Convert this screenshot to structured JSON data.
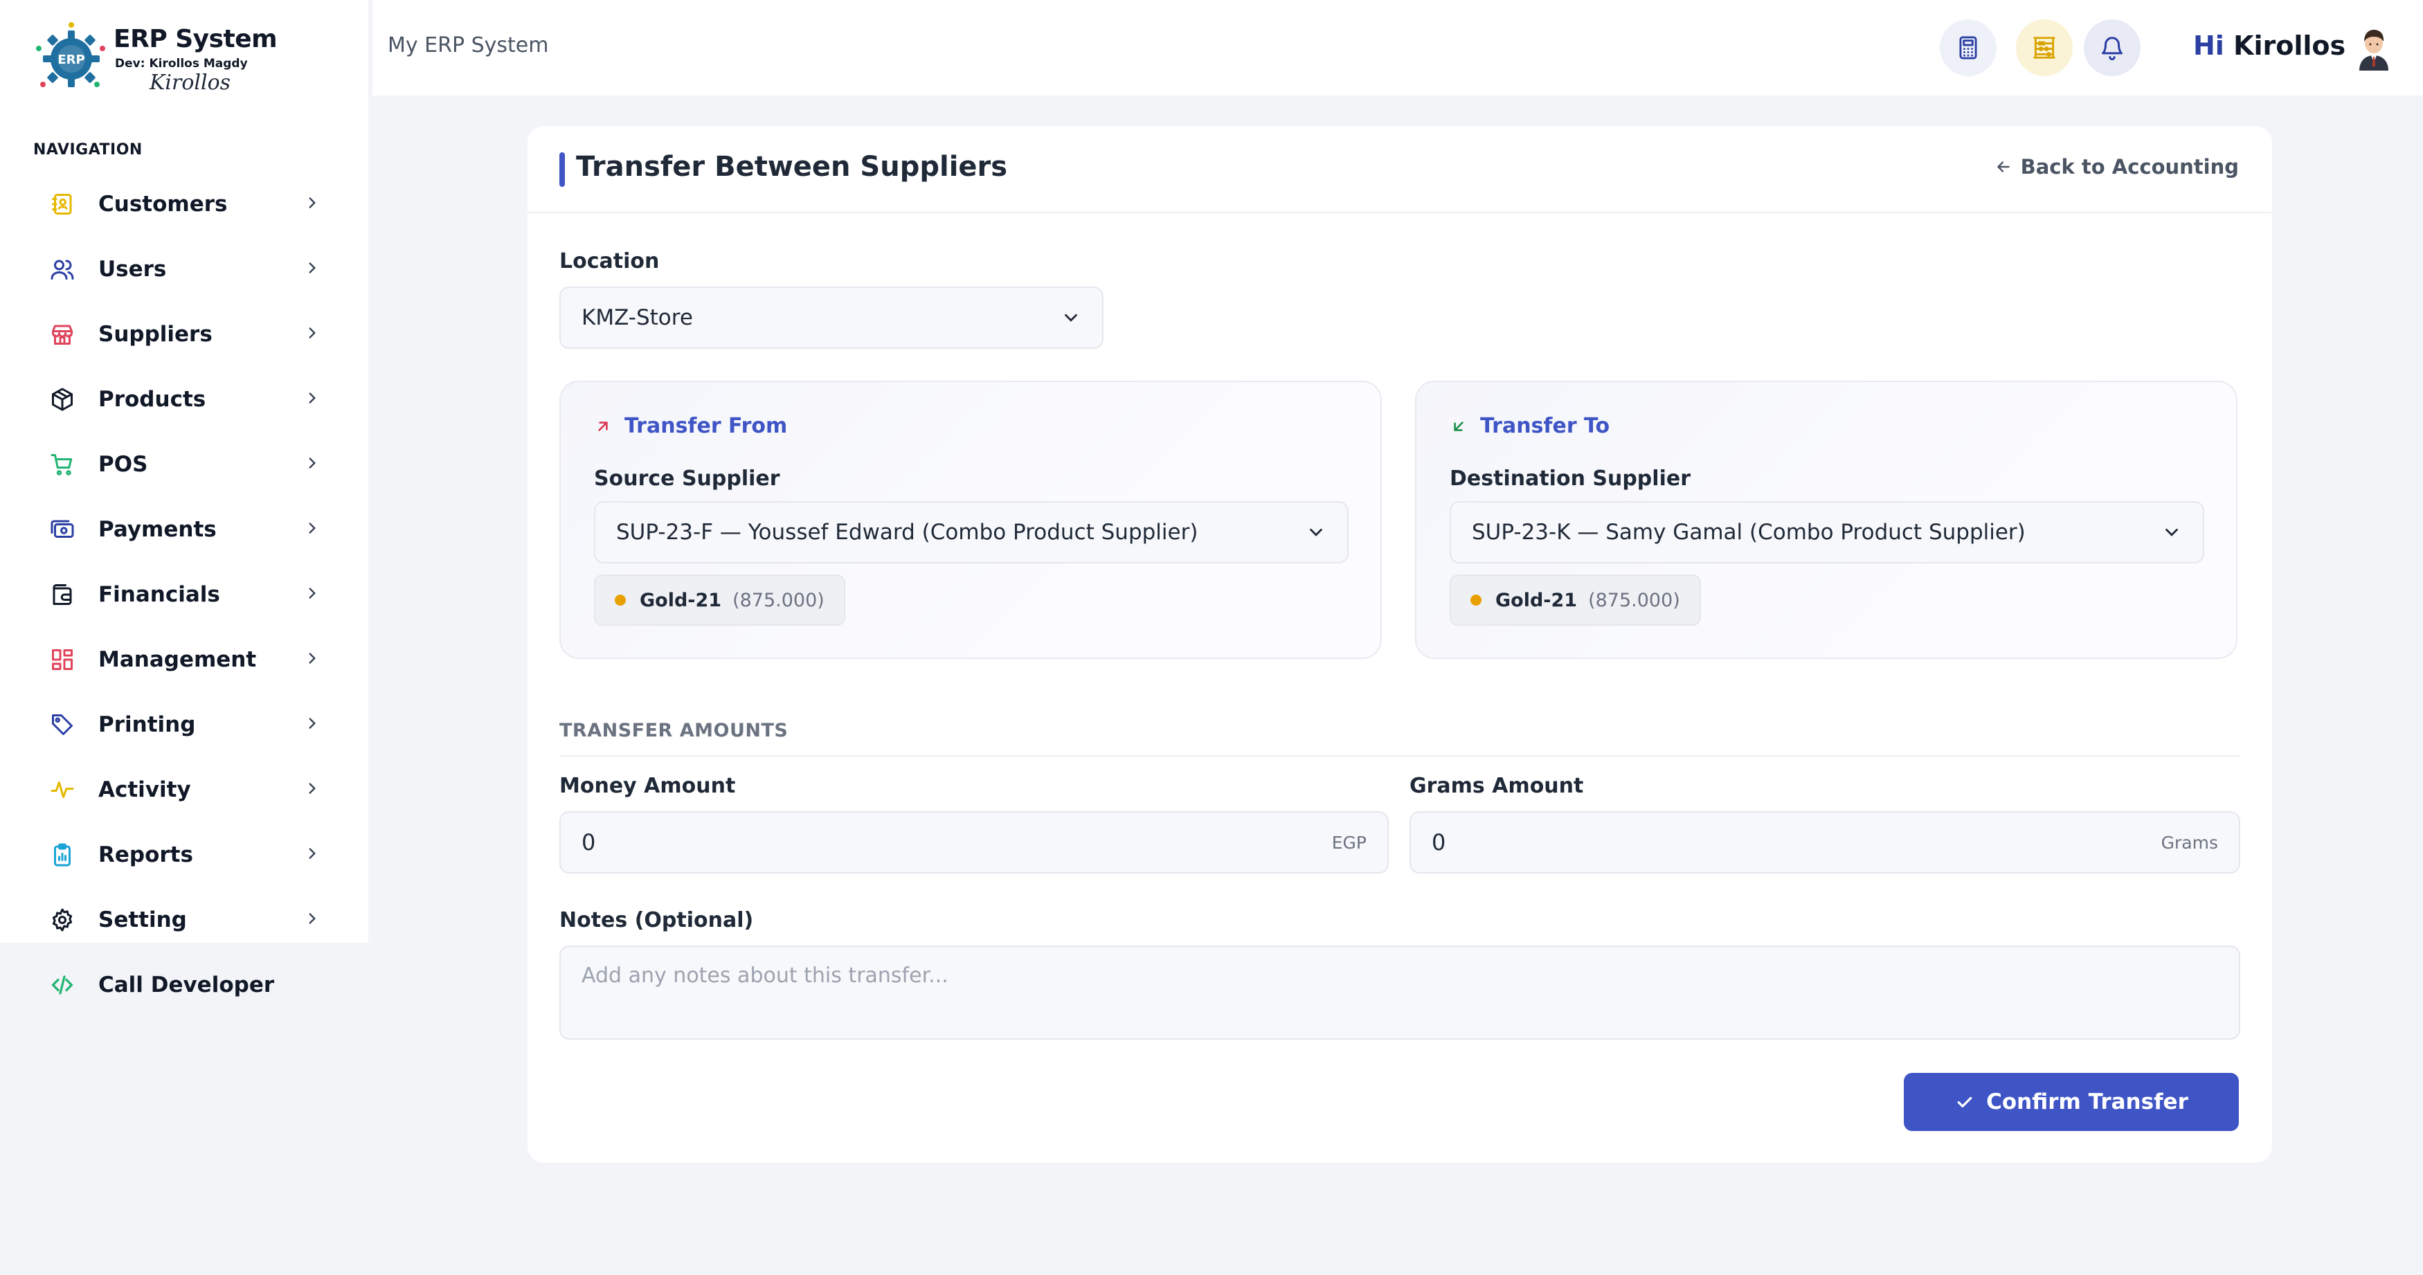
{
  "brand": {
    "logo_text": "ERP",
    "title": "ERP System",
    "dev": "Dev: Kirollos Magdy",
    "signature": "Kirollos"
  },
  "sidebar": {
    "heading": "NAVIGATION",
    "items": [
      {
        "label": "Customers",
        "icon": "contact-book-icon",
        "color": "#e5b800"
      },
      {
        "label": "Users",
        "icon": "users-icon",
        "color": "#2b3fa3"
      },
      {
        "label": "Suppliers",
        "icon": "store-icon",
        "color": "#e0445c"
      },
      {
        "label": "Products",
        "icon": "box-icon",
        "color": "#111827"
      },
      {
        "label": "POS",
        "icon": "cart-icon",
        "color": "#22b573"
      },
      {
        "label": "Payments",
        "icon": "money-icon",
        "color": "#2b3fa3"
      },
      {
        "label": "Financials",
        "icon": "wallet-icon",
        "color": "#111827"
      },
      {
        "label": "Management",
        "icon": "grid-icon",
        "color": "#e0445c"
      },
      {
        "label": "Printing",
        "icon": "tag-icon",
        "color": "#2b3fa3"
      },
      {
        "label": "Activity",
        "icon": "pulse-icon",
        "color": "#e5b800"
      },
      {
        "label": "Reports",
        "icon": "clipboard-icon",
        "color": "#1aa3d6"
      },
      {
        "label": "Setting",
        "icon": "gear-icon",
        "color": "#111827"
      }
    ],
    "call_developer": "Call Developer"
  },
  "topbar": {
    "app_name": "My ERP System",
    "greeting_hi": "Hi",
    "user_name": "Kirollos"
  },
  "page": {
    "title": "Transfer Between Suppliers",
    "back_label": "Back to Accounting",
    "location_label": "Location",
    "location_value": "KMZ-Store",
    "from": {
      "heading": "Transfer From",
      "label": "Source Supplier",
      "value": "SUP-23-F — Youssef Edward (Combo Product Supplier)",
      "tag_name": "Gold-21",
      "tag_qty": "(875.000)"
    },
    "to": {
      "heading": "Transfer To",
      "label": "Destination Supplier",
      "value": "SUP-23-K — Samy Gamal (Combo Product Supplier)",
      "tag_name": "Gold-21",
      "tag_qty": "(875.000)"
    },
    "amounts_title": "TRANSFER AMOUNTS",
    "money_label": "Money Amount",
    "money_value": "0",
    "money_unit": "EGP",
    "grams_label": "Grams Amount",
    "grams_value": "0",
    "grams_unit": "Grams",
    "notes_label": "Notes (Optional)",
    "notes_placeholder": "Add any notes about this transfer...",
    "confirm_label": "Confirm Transfer"
  },
  "colors": {
    "accent": "#3f55c6",
    "gold_dot": "#e8a000",
    "arrow_from": "#d9384f",
    "arrow_to": "#1a8f4a"
  }
}
